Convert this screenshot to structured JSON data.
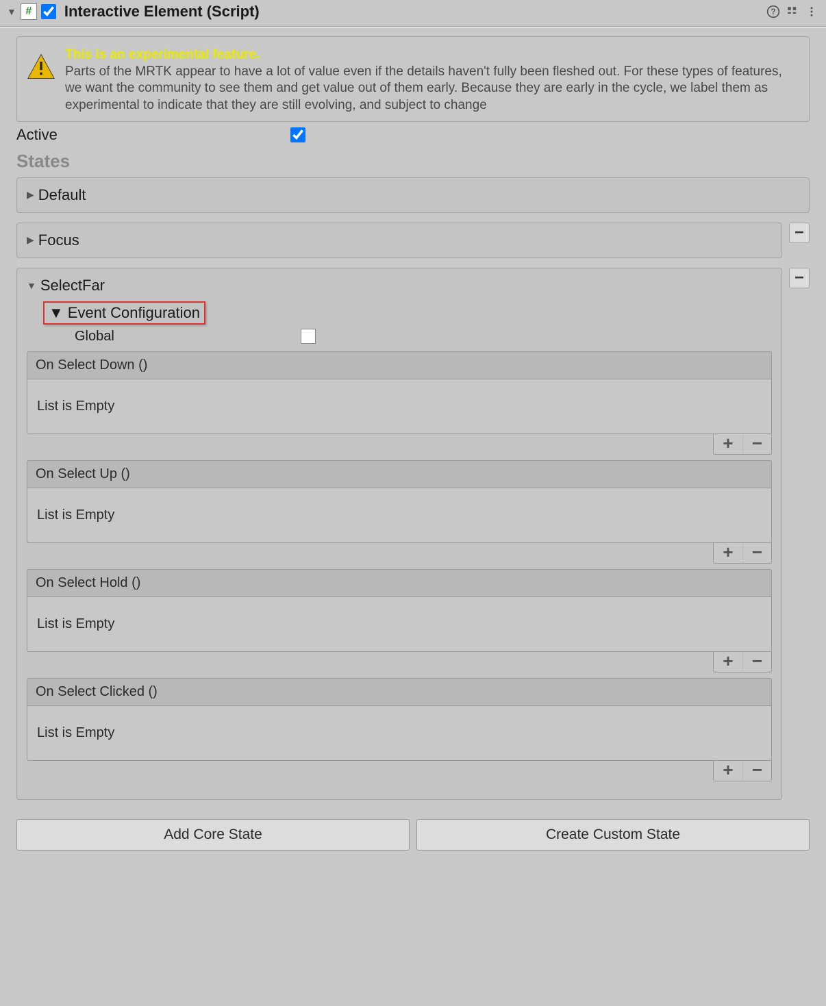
{
  "header": {
    "title": "Interactive Element (Script)",
    "enabled": true
  },
  "warning": {
    "headline": "This is an experimental feature.",
    "body": "Parts of the MRTK appear to have a lot of value even if the details haven't fully been fleshed out. For these types of features, we want the community to see them and get value out of them early. Because they are early in the cycle, we label them as experimental to indicate that they are still evolving, and subject to change"
  },
  "active": {
    "label": "Active",
    "value": true
  },
  "sections": {
    "states": "States"
  },
  "states": {
    "default": {
      "label": "Default"
    },
    "focus": {
      "label": "Focus"
    },
    "selectFar": {
      "label": "SelectFar",
      "eventConfig": {
        "label": "Event Configuration"
      },
      "global": {
        "label": "Global",
        "value": false
      },
      "events": [
        {
          "title": "On Select Down ()",
          "empty_text": "List is Empty"
        },
        {
          "title": "On Select Up ()",
          "empty_text": "List is Empty"
        },
        {
          "title": "On Select Hold ()",
          "empty_text": "List is Empty"
        },
        {
          "title": "On Select Clicked ()",
          "empty_text": "List is Empty"
        }
      ]
    }
  },
  "buttons": {
    "add_core": "Add Core State",
    "create_custom": "Create Custom State"
  },
  "glyphs": {
    "plus": "+",
    "minus": "−"
  }
}
